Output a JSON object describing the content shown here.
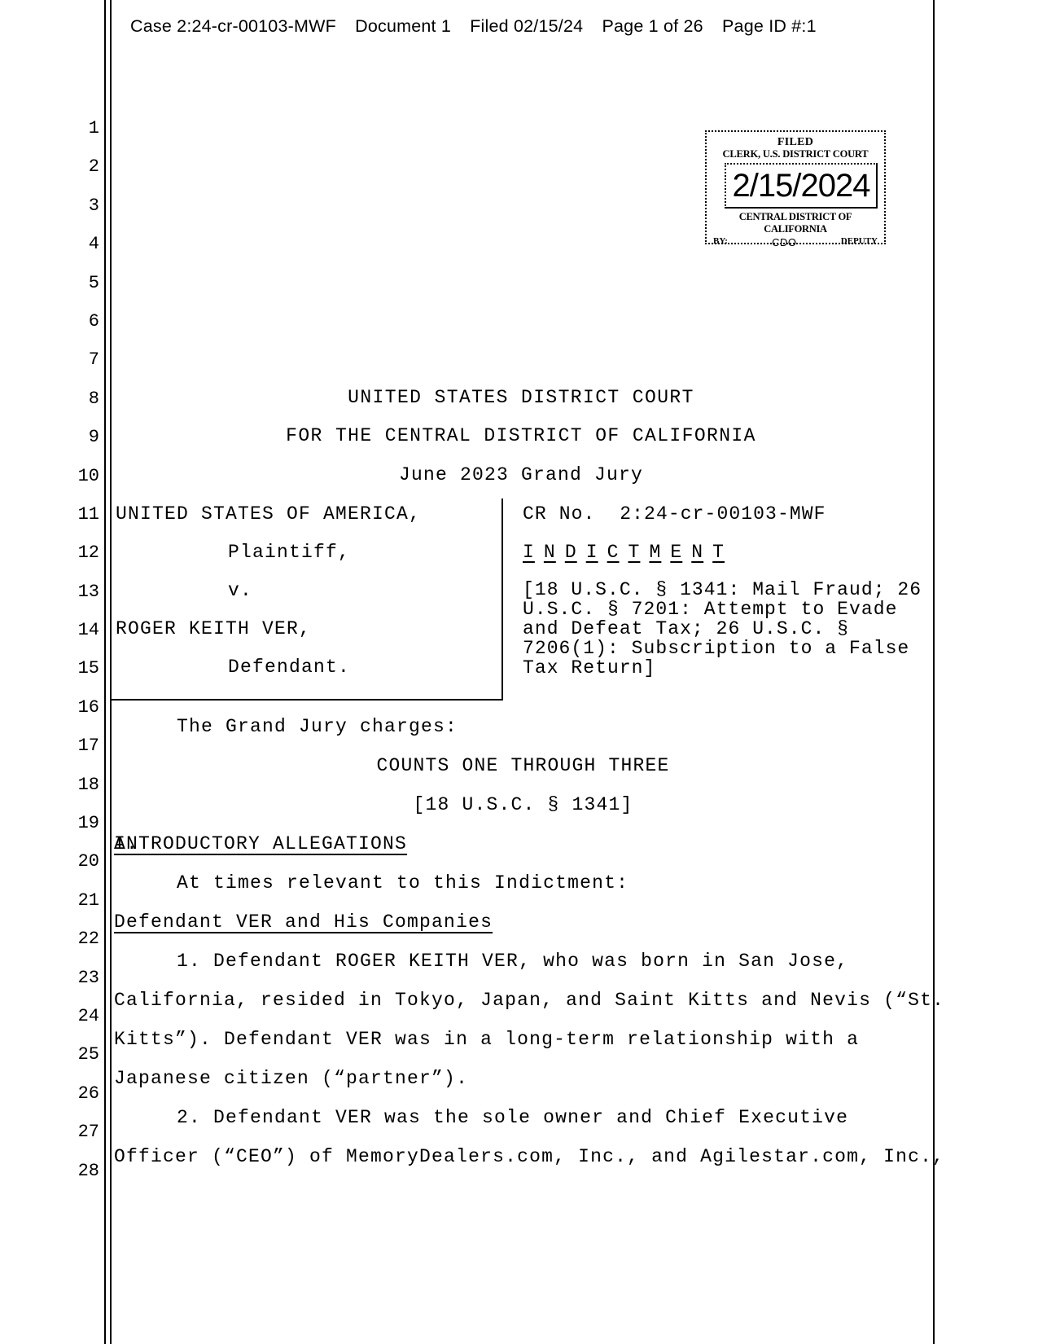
{
  "ecf_header": {
    "case": "Case 2:24-cr-00103-MWF",
    "document": "Document 1",
    "filed": "Filed 02/15/24",
    "page": "Page 1 of 26",
    "page_id": "Page ID #:1"
  },
  "filed_stamp": {
    "title": "FILED",
    "clerk": "CLERK, U.S. DISTRICT COURT",
    "date": "2/15/2024",
    "district": "CENTRAL DISTRICT OF CALIFORNIA",
    "by_label": "BY:",
    "deputy_initials": "CDO",
    "deputy_label": "DEPUTY"
  },
  "line_numbers": [
    "1",
    "2",
    "3",
    "4",
    "5",
    "6",
    "7",
    "8",
    "9",
    "10",
    "11",
    "12",
    "13",
    "14",
    "15",
    "16",
    "17",
    "18",
    "19",
    "20",
    "21",
    "22",
    "23",
    "24",
    "25",
    "26",
    "27",
    "28"
  ],
  "court": {
    "name": "UNITED STATES DISTRICT COURT",
    "district": "FOR THE CENTRAL DISTRICT OF CALIFORNIA",
    "grand_jury": "June 2023 Grand Jury"
  },
  "caption": {
    "plaintiff_name": "UNITED STATES OF AMERICA,",
    "plaintiff_role": "Plaintiff,",
    "versus": "v.",
    "defendant_name": "ROGER KEITH VER,",
    "defendant_role": "Defendant.",
    "cr_no_label": "CR No.",
    "cr_no_value": "2:24-cr-00103-MWF",
    "indictment_letters": [
      "I",
      "N",
      "D",
      "I",
      "C",
      "T",
      "M",
      "E",
      "N",
      "T"
    ],
    "statutes": [
      "[18 U.S.C. § 1341: Mail Fraud; 26",
      "U.S.C. § 7201: Attempt to Evade",
      "and Defeat Tax; 26 U.S.C. §",
      "7206(1): Subscription to a False",
      "Tax Return]"
    ]
  },
  "body": {
    "charges_intro": "The Grand Jury charges:",
    "counts_heading": "COUNTS ONE THROUGH THREE",
    "counts_statute": "[18 U.S.C. § 1341]",
    "section_letter": "A.",
    "section_title": "INTRODUCTORY ALLEGATIONS",
    "at_times": "At times relevant to this Indictment:",
    "subheading": "Defendant VER and His Companies",
    "paragraph_1": [
      "1.   Defendant ROGER KEITH VER, who was born in San Jose,",
      "California, resided in Tokyo, Japan, and Saint Kitts and Nevis (“St.",
      "Kitts”). Defendant VER was in a long-term relationship with a",
      "Japanese citizen (“partner”)."
    ],
    "paragraph_2": [
      "2.   Defendant VER was the sole owner and Chief Executive",
      "Officer (“CEO”) of MemoryDealers.com, Inc., and Agilestar.com, Inc.,"
    ]
  }
}
